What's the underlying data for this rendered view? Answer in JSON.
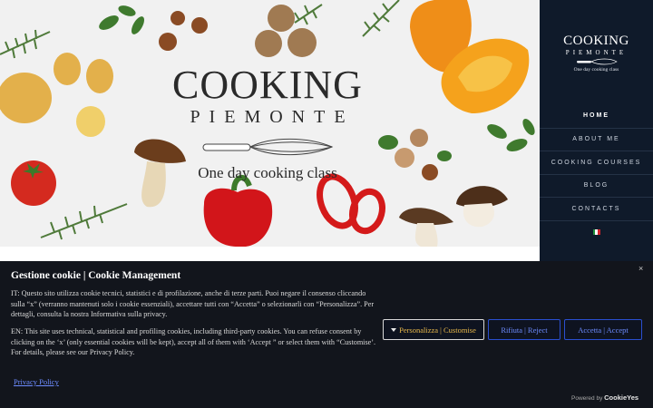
{
  "hero": {
    "logo_cooking": "COOKING",
    "logo_piemonte": "PIEMONTE",
    "logo_tagline": "One day cooking class"
  },
  "sidebar": {
    "logo_cooking": "COOKING",
    "logo_piemonte": "PIEMONTE",
    "logo_tagline": "One day cooking class",
    "nav": [
      {
        "label": "HOME",
        "active": true
      },
      {
        "label": "ABOUT ME"
      },
      {
        "label": "COOKING COURSES"
      },
      {
        "label": "BLOG"
      },
      {
        "label": "CONTACTS"
      }
    ],
    "language_icon": "italian-flag-icon"
  },
  "cookie": {
    "title": "Gestione cookie | Cookie Management",
    "close_label": "×",
    "text_it": "IT: Questo sito utilizza cookie tecnici, statistici e di profilazione, anche di terze parti. Puoi negare il consenso cliccando sulla “x” (verranno mantenuti solo i cookie essenziali), accettare tutti con “Accetta” o selezionarli con “Personalizza”. Per dettagli, consulta la nostra Informativa sulla privacy.",
    "text_en": "EN: This site uses technical, statistical and profiling cookies, including third-party cookies. You can refuse consent by clicking on the ‘x’ (only essential cookies will be kept), accept all of them with ‘Accept ” or select them with “Customise’. For details, please see our Privacy Policy.",
    "customise_label": "Personalizza | Customise",
    "reject_label": "Rifiuta | Reject",
    "accept_label": "Accetta | Accept",
    "privacy_link": "Privacy Policy",
    "powered_by": "Powered by",
    "powered_brand": "CookieYes"
  },
  "colors": {
    "sidebar_bg": "#0f1a2a",
    "banner_bg": "#12151c",
    "accent_blue": "#2a4fd0",
    "link_blue": "#6d8cff"
  }
}
